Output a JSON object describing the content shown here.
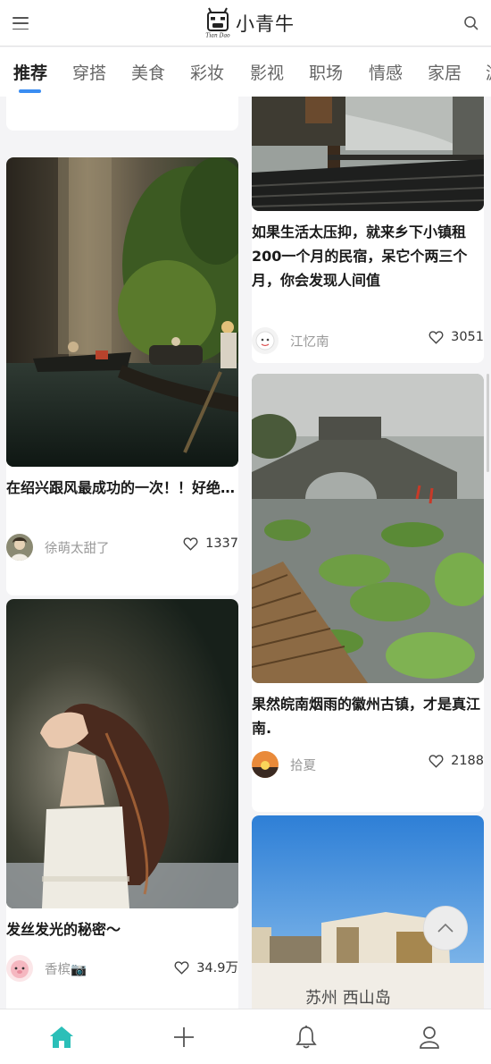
{
  "app": {
    "name": "小青牛",
    "logo_caption": "Tian Dao"
  },
  "tabs": [
    {
      "label": "推荐"
    },
    {
      "label": "穿搭"
    },
    {
      "label": "美食"
    },
    {
      "label": "彩妆"
    },
    {
      "label": "影视"
    },
    {
      "label": "职场"
    },
    {
      "label": "情感"
    },
    {
      "label": "家居"
    },
    {
      "label": "游"
    }
  ],
  "feed": {
    "left": [
      {
        "title": "在绍兴跟风最成功的一次！！好绝…",
        "author": "徐萌太甜了",
        "likes": "1337"
      },
      {
        "title": "发丝发光的秘密～",
        "author": "香槟📷",
        "likes": "34.9万"
      }
    ],
    "right": [
      {
        "title": "如果生活太压抑，就来乡下小镇租200一个月的民宿，呆它个两三个月，你会发现人间值",
        "author": "江忆南",
        "likes": "3051"
      },
      {
        "title": "果然皖南烟雨的徽州古镇，才是真江南.",
        "author": "拾夏",
        "likes": "2188"
      },
      {
        "image_text": "苏州 西山岛"
      }
    ]
  },
  "colors": {
    "accent": "#3a8df2",
    "home_active": "#2bbfb8"
  },
  "icons": {
    "menu": "menu-icon",
    "search": "search-icon",
    "like": "heart-icon",
    "back_to_top": "chevron-up-icon",
    "home": "home-icon",
    "publish": "plus-icon",
    "notifications": "bell-icon",
    "profile": "user-icon"
  }
}
